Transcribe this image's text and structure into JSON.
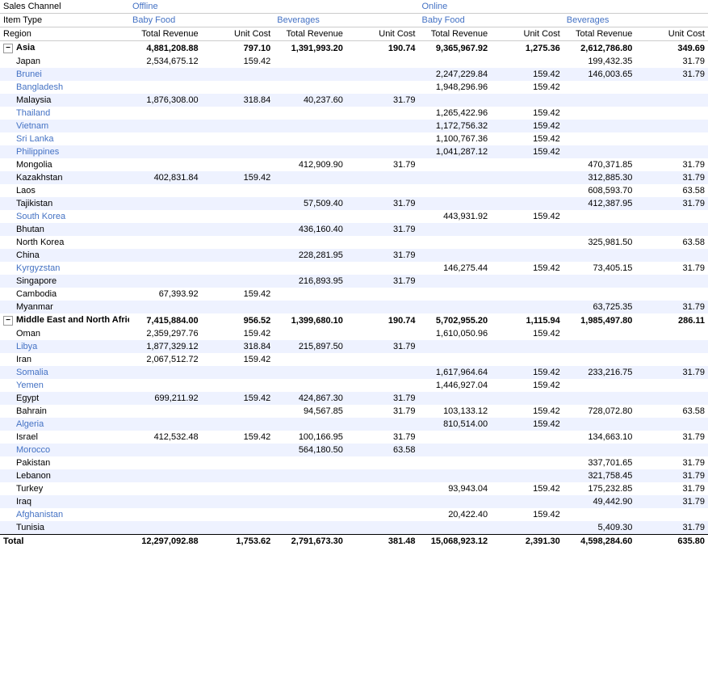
{
  "headers": {
    "row1": {
      "col1": "Sales Channel",
      "offline_label": "Offline",
      "online_label": "Online"
    },
    "row2": {
      "col1": "Item Type",
      "baby_food_off": "Baby Food",
      "beverages_off": "Beverages",
      "baby_food_on": "Baby Food",
      "beverages_on": "Beverages"
    },
    "row3": {
      "col1": "Region",
      "total_rev1": "Total Revenue",
      "unit_cost1": "Unit Cost",
      "total_rev2": "Total Revenue",
      "unit_cost2": "Unit Cost",
      "total_rev3": "Total Revenue",
      "unit_cost3": "Unit Cost",
      "total_rev4": "Total Revenue",
      "unit_cost4": "Unit Cost"
    }
  },
  "groups": [
    {
      "id": "asia",
      "label": "Asia",
      "expand_icon": "−",
      "totals": {
        "off_bf_rev": "4,881,208.88",
        "off_bf_uc": "797.10",
        "off_bev_rev": "1,391,993.20",
        "off_bev_uc": "190.74",
        "on_bf_rev": "9,365,967.92",
        "on_bf_uc": "1,275.36",
        "on_bev_rev": "2,612,786.80",
        "on_bev_uc": "349.69"
      },
      "rows": [
        {
          "label": "Japan",
          "alt": false,
          "blue": false,
          "off_bf_rev": "2,534,675.12",
          "off_bf_uc": "159.42",
          "off_bev_rev": "",
          "off_bev_uc": "",
          "on_bf_rev": "",
          "on_bf_uc": "",
          "on_bev_rev": "199,432.35",
          "on_bev_uc": "31.79"
        },
        {
          "label": "Brunei",
          "alt": true,
          "blue": true,
          "off_bf_rev": "",
          "off_bf_uc": "",
          "off_bev_rev": "",
          "off_bev_uc": "",
          "on_bf_rev": "2,247,229.84",
          "on_bf_uc": "159.42",
          "on_bev_rev": "146,003.65",
          "on_bev_uc": "31.79"
        },
        {
          "label": "Bangladesh",
          "alt": false,
          "blue": true,
          "off_bf_rev": "",
          "off_bf_uc": "",
          "off_bev_rev": "",
          "off_bev_uc": "",
          "on_bf_rev": "1,948,296.96",
          "on_bf_uc": "159.42",
          "on_bev_rev": "",
          "on_bev_uc": ""
        },
        {
          "label": "Malaysia",
          "alt": true,
          "blue": false,
          "off_bf_rev": "1,876,308.00",
          "off_bf_uc": "318.84",
          "off_bev_rev": "40,237.60",
          "off_bev_uc": "31.79",
          "on_bf_rev": "",
          "on_bf_uc": "",
          "on_bev_rev": "",
          "on_bev_uc": ""
        },
        {
          "label": "Thailand",
          "alt": false,
          "blue": true,
          "off_bf_rev": "",
          "off_bf_uc": "",
          "off_bev_rev": "",
          "off_bev_uc": "",
          "on_bf_rev": "1,265,422.96",
          "on_bf_uc": "159.42",
          "on_bev_rev": "",
          "on_bev_uc": ""
        },
        {
          "label": "Vietnam",
          "alt": true,
          "blue": true,
          "off_bf_rev": "",
          "off_bf_uc": "",
          "off_bev_rev": "",
          "off_bev_uc": "",
          "on_bf_rev": "1,172,756.32",
          "on_bf_uc": "159.42",
          "on_bev_rev": "",
          "on_bev_uc": ""
        },
        {
          "label": "Sri Lanka",
          "alt": false,
          "blue": true,
          "off_bf_rev": "",
          "off_bf_uc": "",
          "off_bev_rev": "",
          "off_bev_uc": "",
          "on_bf_rev": "1,100,767.36",
          "on_bf_uc": "159.42",
          "on_bev_rev": "",
          "on_bev_uc": ""
        },
        {
          "label": "Philippines",
          "alt": true,
          "blue": true,
          "off_bf_rev": "",
          "off_bf_uc": "",
          "off_bev_rev": "",
          "off_bev_uc": "",
          "on_bf_rev": "1,041,287.12",
          "on_bf_uc": "159.42",
          "on_bev_rev": "",
          "on_bev_uc": ""
        },
        {
          "label": "Mongolia",
          "alt": false,
          "blue": false,
          "off_bf_rev": "",
          "off_bf_uc": "",
          "off_bev_rev": "412,909.90",
          "off_bev_uc": "31.79",
          "on_bf_rev": "",
          "on_bf_uc": "",
          "on_bev_rev": "470,371.85",
          "on_bev_uc": "31.79"
        },
        {
          "label": "Kazakhstan",
          "alt": true,
          "blue": false,
          "off_bf_rev": "402,831.84",
          "off_bf_uc": "159.42",
          "off_bev_rev": "",
          "off_bev_uc": "",
          "on_bf_rev": "",
          "on_bf_uc": "",
          "on_bev_rev": "312,885.30",
          "on_bev_uc": "31.79"
        },
        {
          "label": "Laos",
          "alt": false,
          "blue": false,
          "off_bf_rev": "",
          "off_bf_uc": "",
          "off_bev_rev": "",
          "off_bev_uc": "",
          "on_bf_rev": "",
          "on_bf_uc": "",
          "on_bev_rev": "608,593.70",
          "on_bev_uc": "63.58"
        },
        {
          "label": "Tajikistan",
          "alt": true,
          "blue": false,
          "off_bf_rev": "",
          "off_bf_uc": "",
          "off_bev_rev": "57,509.40",
          "off_bev_uc": "31.79",
          "on_bf_rev": "",
          "on_bf_uc": "",
          "on_bev_rev": "412,387.95",
          "on_bev_uc": "31.79"
        },
        {
          "label": "South Korea",
          "alt": false,
          "blue": true,
          "off_bf_rev": "",
          "off_bf_uc": "",
          "off_bev_rev": "",
          "off_bev_uc": "",
          "on_bf_rev": "443,931.92",
          "on_bf_uc": "159.42",
          "on_bev_rev": "",
          "on_bev_uc": ""
        },
        {
          "label": "Bhutan",
          "alt": true,
          "blue": false,
          "off_bf_rev": "",
          "off_bf_uc": "",
          "off_bev_rev": "436,160.40",
          "off_bev_uc": "31.79",
          "on_bf_rev": "",
          "on_bf_uc": "",
          "on_bev_rev": "",
          "on_bev_uc": ""
        },
        {
          "label": "North Korea",
          "alt": false,
          "blue": false,
          "off_bf_rev": "",
          "off_bf_uc": "",
          "off_bev_rev": "",
          "off_bev_uc": "",
          "on_bf_rev": "",
          "on_bf_uc": "",
          "on_bev_rev": "325,981.50",
          "on_bev_uc": "63.58"
        },
        {
          "label": "China",
          "alt": true,
          "blue": false,
          "off_bf_rev": "",
          "off_bf_uc": "",
          "off_bev_rev": "228,281.95",
          "off_bev_uc": "31.79",
          "on_bf_rev": "",
          "on_bf_uc": "",
          "on_bev_rev": "",
          "on_bev_uc": ""
        },
        {
          "label": "Kyrgyzstan",
          "alt": false,
          "blue": true,
          "off_bf_rev": "",
          "off_bf_uc": "",
          "off_bev_rev": "",
          "off_bev_uc": "",
          "on_bf_rev": "146,275.44",
          "on_bf_uc": "159.42",
          "on_bev_rev": "73,405.15",
          "on_bev_uc": "31.79"
        },
        {
          "label": "Singapore",
          "alt": true,
          "blue": false,
          "off_bf_rev": "",
          "off_bf_uc": "",
          "off_bev_rev": "216,893.95",
          "off_bev_uc": "31.79",
          "on_bf_rev": "",
          "on_bf_uc": "",
          "on_bev_rev": "",
          "on_bev_uc": ""
        },
        {
          "label": "Cambodia",
          "alt": false,
          "blue": false,
          "off_bf_rev": "67,393.92",
          "off_bf_uc": "159.42",
          "off_bev_rev": "",
          "off_bev_uc": "",
          "on_bf_rev": "",
          "on_bf_uc": "",
          "on_bev_rev": "",
          "on_bev_uc": ""
        },
        {
          "label": "Myanmar",
          "alt": true,
          "blue": false,
          "off_bf_rev": "",
          "off_bf_uc": "",
          "off_bev_rev": "",
          "off_bev_uc": "",
          "on_bf_rev": "",
          "on_bf_uc": "",
          "on_bev_rev": "63,725.35",
          "on_bev_uc": "31.79"
        }
      ]
    },
    {
      "id": "mena",
      "label": "Middle East and North Africa",
      "expand_icon": "−",
      "totals": {
        "off_bf_rev": "7,415,884.00",
        "off_bf_uc": "956.52",
        "off_bev_rev": "1,399,680.10",
        "off_bev_uc": "190.74",
        "on_bf_rev": "5,702,955.20",
        "on_bf_uc": "1,115.94",
        "on_bev_rev": "1,985,497.80",
        "on_bev_uc": "286.11"
      },
      "rows": [
        {
          "label": "Oman",
          "alt": false,
          "blue": false,
          "off_bf_rev": "2,359,297.76",
          "off_bf_uc": "159.42",
          "off_bev_rev": "",
          "off_bev_uc": "",
          "on_bf_rev": "1,610,050.96",
          "on_bf_uc": "159.42",
          "on_bev_rev": "",
          "on_bev_uc": ""
        },
        {
          "label": "Libya",
          "alt": true,
          "blue": true,
          "off_bf_rev": "1,877,329.12",
          "off_bf_uc": "318.84",
          "off_bev_rev": "215,897.50",
          "off_bev_uc": "31.79",
          "on_bf_rev": "",
          "on_bf_uc": "",
          "on_bev_rev": "",
          "on_bev_uc": ""
        },
        {
          "label": "Iran",
          "alt": false,
          "blue": false,
          "off_bf_rev": "2,067,512.72",
          "off_bf_uc": "159.42",
          "off_bev_rev": "",
          "off_bev_uc": "",
          "on_bf_rev": "",
          "on_bf_uc": "",
          "on_bev_rev": "",
          "on_bev_uc": ""
        },
        {
          "label": "Somalia",
          "alt": true,
          "blue": true,
          "off_bf_rev": "",
          "off_bf_uc": "",
          "off_bev_rev": "",
          "off_bev_uc": "",
          "on_bf_rev": "1,617,964.64",
          "on_bf_uc": "159.42",
          "on_bev_rev": "233,216.75",
          "on_bev_uc": "31.79"
        },
        {
          "label": "Yemen",
          "alt": false,
          "blue": true,
          "off_bf_rev": "",
          "off_bf_uc": "",
          "off_bev_rev": "",
          "off_bev_uc": "",
          "on_bf_rev": "1,446,927.04",
          "on_bf_uc": "159.42",
          "on_bev_rev": "",
          "on_bev_uc": ""
        },
        {
          "label": "Egypt",
          "alt": true,
          "blue": false,
          "off_bf_rev": "699,211.92",
          "off_bf_uc": "159.42",
          "off_bev_rev": "424,867.30",
          "off_bev_uc": "31.79",
          "on_bf_rev": "",
          "on_bf_uc": "",
          "on_bev_rev": "",
          "on_bev_uc": ""
        },
        {
          "label": "Bahrain",
          "alt": false,
          "blue": false,
          "off_bf_rev": "",
          "off_bf_uc": "",
          "off_bev_rev": "94,567.85",
          "off_bev_uc": "31.79",
          "on_bf_rev": "103,133.12",
          "on_bf_uc": "159.42",
          "on_bev_rev": "728,072.80",
          "on_bev_uc": "63.58"
        },
        {
          "label": "Algeria",
          "alt": true,
          "blue": true,
          "off_bf_rev": "",
          "off_bf_uc": "",
          "off_bev_rev": "",
          "off_bev_uc": "",
          "on_bf_rev": "810,514.00",
          "on_bf_uc": "159.42",
          "on_bev_rev": "",
          "on_bev_uc": ""
        },
        {
          "label": "Israel",
          "alt": false,
          "blue": false,
          "off_bf_rev": "412,532.48",
          "off_bf_uc": "159.42",
          "off_bev_rev": "100,166.95",
          "off_bev_uc": "31.79",
          "on_bf_rev": "",
          "on_bf_uc": "",
          "on_bev_rev": "134,663.10",
          "on_bev_uc": "31.79"
        },
        {
          "label": "Morocco",
          "alt": true,
          "blue": true,
          "off_bf_rev": "",
          "off_bf_uc": "",
          "off_bev_rev": "564,180.50",
          "off_bev_uc": "63.58",
          "on_bf_rev": "",
          "on_bf_uc": "",
          "on_bev_rev": "",
          "on_bev_uc": ""
        },
        {
          "label": "Pakistan",
          "alt": false,
          "blue": false,
          "off_bf_rev": "",
          "off_bf_uc": "",
          "off_bev_rev": "",
          "off_bev_uc": "",
          "on_bf_rev": "",
          "on_bf_uc": "",
          "on_bev_rev": "337,701.65",
          "on_bev_uc": "31.79"
        },
        {
          "label": "Lebanon",
          "alt": true,
          "blue": false,
          "off_bf_rev": "",
          "off_bf_uc": "",
          "off_bev_rev": "",
          "off_bev_uc": "",
          "on_bf_rev": "",
          "on_bf_uc": "",
          "on_bev_rev": "321,758.45",
          "on_bev_uc": "31.79"
        },
        {
          "label": "Turkey",
          "alt": false,
          "blue": false,
          "off_bf_rev": "",
          "off_bf_uc": "",
          "off_bev_rev": "",
          "off_bev_uc": "",
          "on_bf_rev": "93,943.04",
          "on_bf_uc": "159.42",
          "on_bev_rev": "175,232.85",
          "on_bev_uc": "31.79"
        },
        {
          "label": "Iraq",
          "alt": true,
          "blue": false,
          "off_bf_rev": "",
          "off_bf_uc": "",
          "off_bev_rev": "",
          "off_bev_uc": "",
          "on_bf_rev": "",
          "on_bf_uc": "",
          "on_bev_rev": "49,442.90",
          "on_bev_uc": "31.79"
        },
        {
          "label": "Afghanistan",
          "alt": false,
          "blue": true,
          "off_bf_rev": "",
          "off_bf_uc": "",
          "off_bev_rev": "",
          "off_bev_uc": "",
          "on_bf_rev": "20,422.40",
          "on_bf_uc": "159.42",
          "on_bev_rev": "",
          "on_bev_uc": ""
        },
        {
          "label": "Tunisia",
          "alt": true,
          "blue": false,
          "off_bf_rev": "",
          "off_bf_uc": "",
          "off_bev_rev": "",
          "off_bev_uc": "",
          "on_bf_rev": "",
          "on_bf_uc": "",
          "on_bev_rev": "5,409.30",
          "on_bev_uc": "31.79"
        }
      ]
    }
  ],
  "total_row": {
    "label": "Total",
    "off_bf_rev": "12,297,092.88",
    "off_bf_uc": "1,753.62",
    "off_bev_rev": "2,791,673.30",
    "off_bev_uc": "381.48",
    "on_bf_rev": "15,068,923.12",
    "on_bf_uc": "2,391.30",
    "on_bev_rev": "4,598,284.60",
    "on_bev_uc": "635.80"
  }
}
